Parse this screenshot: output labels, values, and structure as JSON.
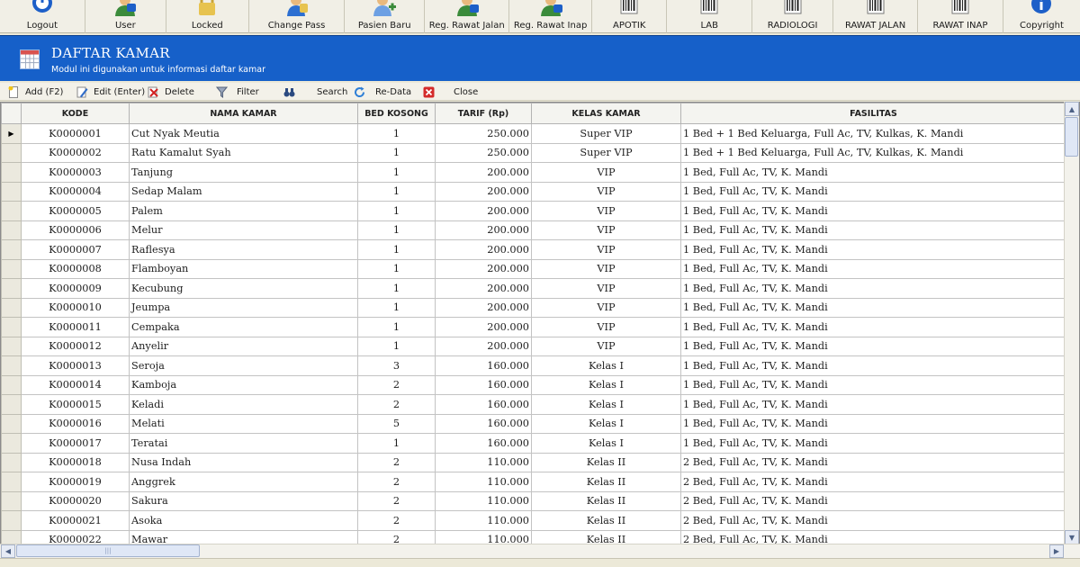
{
  "toolbar": {
    "buttons": [
      {
        "label": "Logout",
        "icon": "logout-icon"
      },
      {
        "label": "User",
        "icon": "user-icon"
      },
      {
        "label": "Locked",
        "icon": "lock-icon"
      },
      {
        "label": "Change Pass",
        "icon": "change-password-icon"
      },
      {
        "label": "Pasien Baru",
        "icon": "new-patient-icon"
      },
      {
        "label": "Reg. Rawat Jalan",
        "icon": "outpatient-registration-icon"
      },
      {
        "label": "Reg. Rawat Inap",
        "icon": "inpatient-registration-icon"
      },
      {
        "label": "APOTIK",
        "icon": "barcode-icon"
      },
      {
        "label": "LAB",
        "icon": "barcode-icon"
      },
      {
        "label": "RADIOLOGI",
        "icon": "barcode-icon"
      },
      {
        "label": "RAWAT JALAN",
        "icon": "barcode-icon"
      },
      {
        "label": "RAWAT INAP",
        "icon": "barcode-icon"
      },
      {
        "label": "Copyright",
        "icon": "info-icon"
      }
    ]
  },
  "module": {
    "title": "DAFTAR KAMAR",
    "subtitle": "Modul ini digunakan untuk informasi daftar kamar",
    "icon": "calendar-grid-icon"
  },
  "actions": {
    "add_label": "Add (F2)",
    "edit_label": "Edit (Enter)",
    "delete_label": "Delete",
    "filter_label": "Filter",
    "search_label": "Search",
    "redata_label": "Re-Data",
    "close_label": "Close"
  },
  "grid": {
    "columns": [
      "KODE",
      "NAMA KAMAR",
      "BED KOSONG",
      "TARIF (Rp)",
      "KELAS KAMAR",
      "FASILITAS"
    ],
    "current_row_marker": "▶",
    "rows": [
      [
        "K0000001",
        "Cut Nyak Meutia",
        "1",
        "250.000",
        "Super VIP",
        "1 Bed + 1 Bed Keluarga, Full Ac, TV, Kulkas, K. Mandi"
      ],
      [
        "K0000002",
        "Ratu Kamalut Syah",
        "1",
        "250.000",
        "Super VIP",
        "1 Bed + 1 Bed Keluarga, Full Ac, TV, Kulkas, K. Mandi"
      ],
      [
        "K0000003",
        "Tanjung",
        "1",
        "200.000",
        "VIP",
        "1 Bed, Full Ac, TV,  K. Mandi"
      ],
      [
        "K0000004",
        "Sedap Malam",
        "1",
        "200.000",
        "VIP",
        "1 Bed, Full Ac, TV,  K. Mandi"
      ],
      [
        "K0000005",
        "Palem",
        "1",
        "200.000",
        "VIP",
        "1 Bed, Full Ac, TV, K. Mandi"
      ],
      [
        "K0000006",
        "Melur",
        "1",
        "200.000",
        "VIP",
        "1 Bed, Full Ac, TV, K. Mandi"
      ],
      [
        "K0000007",
        "Raflesya",
        "1",
        "200.000",
        "VIP",
        "1 Bed, Full Ac, TV, K. Mandi"
      ],
      [
        "K0000008",
        "Flamboyan",
        "1",
        "200.000",
        "VIP",
        "1 Bed, Full Ac, TV, K. Mandi"
      ],
      [
        "K0000009",
        "Kecubung",
        "1",
        "200.000",
        "VIP",
        "1 Bed, Full Ac, TV, K. Mandi"
      ],
      [
        "K0000010",
        "Jeumpa",
        "1",
        "200.000",
        "VIP",
        "1 Bed, Full Ac, TV, K. Mandi"
      ],
      [
        "K0000011",
        "Cempaka",
        "1",
        "200.000",
        "VIP",
        "1 Bed, Full Ac, TV, K. Mandi"
      ],
      [
        "K0000012",
        "Anyelir",
        "1",
        "200.000",
        "VIP",
        "1 Bed, Full Ac, TV, K. Mandi"
      ],
      [
        "K0000013",
        "Seroja",
        "3",
        "160.000",
        "Kelas I",
        "1 Bed, Full Ac, TV, K. Mandi"
      ],
      [
        "K0000014",
        "Kamboja",
        "2",
        "160.000",
        "Kelas I",
        "1 Bed, Full Ac, TV, K. Mandi"
      ],
      [
        "K0000015",
        "Keladi",
        "2",
        "160.000",
        "Kelas I",
        "1 Bed, Full Ac, TV, K. Mandi"
      ],
      [
        "K0000016",
        "Melati",
        "5",
        "160.000",
        "Kelas I",
        "1 Bed, Full Ac, TV, K. Mandi"
      ],
      [
        "K0000017",
        "Teratai",
        "1",
        "160.000",
        "Kelas I",
        "1 Bed, Full Ac, TV, K. Mandi"
      ],
      [
        "K0000018",
        "Nusa Indah",
        "2",
        "110.000",
        "Kelas II",
        "2 Bed, Full Ac, TV, K. Mandi"
      ],
      [
        "K0000019",
        "Anggrek",
        "2",
        "110.000",
        "Kelas II",
        "2 Bed, Full Ac, TV, K. Mandi"
      ],
      [
        "K0000020",
        "Sakura",
        "2",
        "110.000",
        "Kelas II",
        "2 Bed, Full Ac, TV, K. Mandi"
      ],
      [
        "K0000021",
        "Asoka",
        "2",
        "110.000",
        "Kelas II",
        "2 Bed, Full Ac, TV, K. Mandi"
      ],
      [
        "K0000022",
        "Mawar",
        "2",
        "110.000",
        "Kelas II",
        "2 Bed, Full Ac, TV, K. Mandi"
      ]
    ]
  },
  "colors": {
    "header_blue": "#1660c9",
    "grid_border": "#c3c3c3",
    "toolbar_bg": "#f1efe6"
  }
}
